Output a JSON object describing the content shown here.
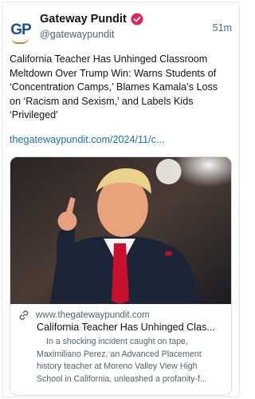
{
  "post": {
    "author": {
      "name": "Gateway Pundit",
      "handle": "@gatewaypundit",
      "avatar_text": "GP",
      "verified": true,
      "verified_color": "#e0245e"
    },
    "time": "51m",
    "text": "California Teacher Has Unhinged Classroom Meltdown Over Trump Win: Warns Students of ‘Concentration Camps,’ Blames Kamala’s Loss on ‘Racism and Sexism,’ and Labels Kids ‘Privileged’",
    "link": "thegatewaypundit.com/2024/11/c...",
    "link_color": "#1d6fb8"
  },
  "card": {
    "image_icon": "photo-speaker-pointing",
    "domain": "www.thegatewaypundit.com",
    "title": "California Teacher Has Unhinged Clas...",
    "description": "In a shocking incident caught on tape, Maximiliano Perez, an Advanced Placement history teacher at Moreno Valley View High School in California, unleashed a profanity-f..."
  }
}
